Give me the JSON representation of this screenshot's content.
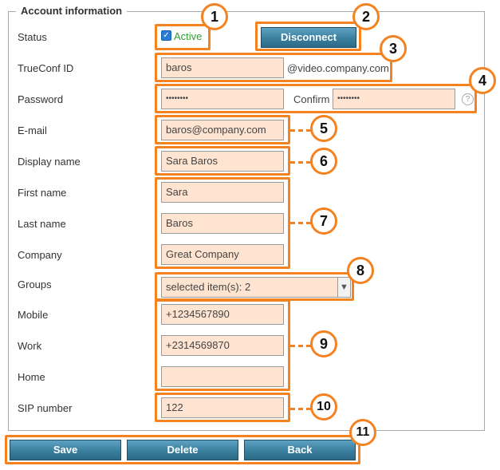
{
  "section": {
    "legend": "Account information"
  },
  "fields": {
    "status": {
      "label": "Status",
      "checked": true,
      "value_label": "Active"
    },
    "trueconf_id": {
      "label": "TrueConf ID",
      "value": "baros",
      "domain": "@video.company.com"
    },
    "password": {
      "label": "Password",
      "value": "••••••••",
      "confirm_label": "Confirm",
      "confirm_value": "••••••••",
      "help": "?"
    },
    "email": {
      "label": "E-mail",
      "value": "baros@company.com"
    },
    "display_name": {
      "label": "Display name",
      "value": "Sara Baros"
    },
    "first_name": {
      "label": "First name",
      "value": "Sara"
    },
    "last_name": {
      "label": "Last name",
      "value": "Baros"
    },
    "company": {
      "label": "Company",
      "value": "Great Company"
    },
    "groups": {
      "label": "Groups",
      "value": "selected item(s): 2"
    },
    "mobile": {
      "label": "Mobile",
      "value": "+1234567890"
    },
    "work": {
      "label": "Work",
      "value": "+2314569870"
    },
    "home": {
      "label": "Home",
      "value": ""
    },
    "sip": {
      "label": "SIP number",
      "value": "122"
    }
  },
  "buttons": {
    "disconnect": "Disconnect",
    "save": "Save",
    "delete": "Delete",
    "back": "Back"
  },
  "badges": [
    "1",
    "2",
    "3",
    "4",
    "5",
    "6",
    "7",
    "8",
    "9",
    "10",
    "11"
  ],
  "colors": {
    "highlight": "#f58220",
    "input_bg": "#ffe4d2",
    "button": "#3a7f9e",
    "active": "#2e9e2e"
  }
}
